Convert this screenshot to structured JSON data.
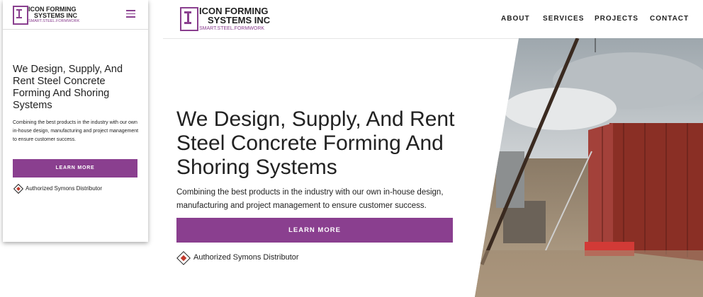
{
  "brand": {
    "line1": "ICON FORMING",
    "line2": "SYSTEMS INC",
    "tagline": "SMART.STEEL.FORMWORK",
    "accent": "#8a3f8f"
  },
  "nav": [
    "ABOUT",
    "SERVICES",
    "PROJECTS",
    "CONTACT"
  ],
  "hero": {
    "title": "We Design, Supply, And Rent Steel Concrete Forming And Shoring Systems",
    "description": "Combining the best products in the industry with our own in-house design, manufacturing and project management to ensure customer success.",
    "button": "LEARN MORE",
    "distributor": "Authorized Symons Distributor"
  },
  "icons": {
    "menu": "hamburger-icon",
    "distributor": "symons-diamond-icon"
  }
}
